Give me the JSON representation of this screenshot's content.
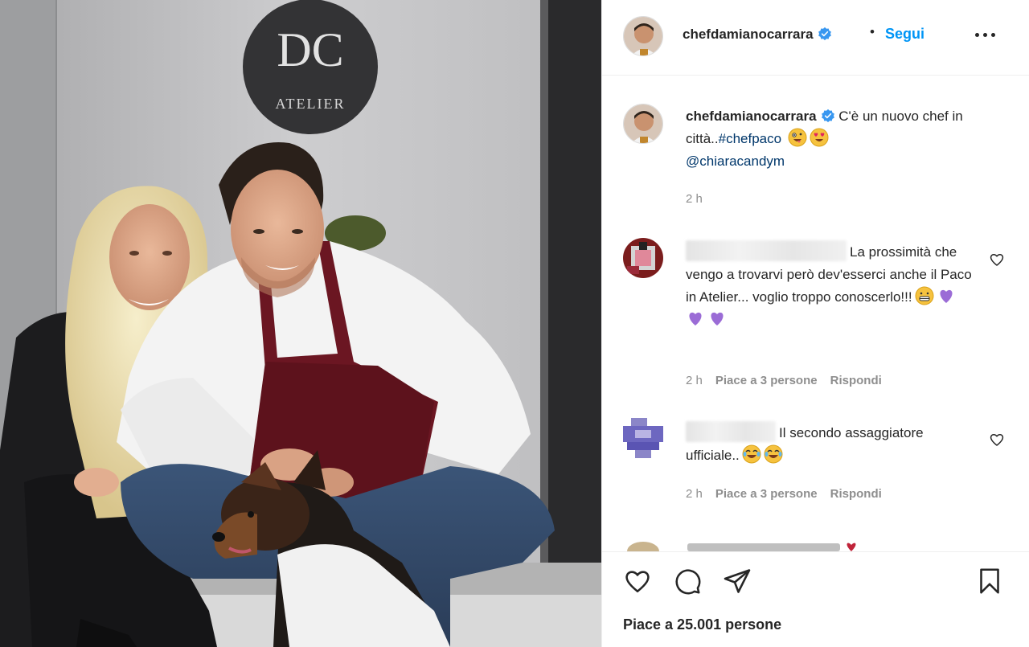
{
  "post": {
    "sign": {
      "monogram": "DC",
      "label": "ATELIER"
    }
  },
  "header": {
    "username": "chefdamianocarrara",
    "separator": "•",
    "follow_label": "Segui"
  },
  "caption": {
    "username": "chefdamianocarrara",
    "text": "C'è un nuovo chef in città..",
    "hashtag": "#chefpaco",
    "mention": "@chiaracandym",
    "time": "2 h"
  },
  "comments": [
    {
      "text": "La prossimità che vengo a trovarvi però dev'esserci anche il Paco in Atelier... voglio troppo conoscerlo!!!",
      "time": "2 h",
      "likes_label": "Piace a 3 persone",
      "reply_label": "Rispondi"
    },
    {
      "text": "Il secondo assaggiatore ufficiale..",
      "time": "2 h",
      "likes_label": "Piace a 3 persone",
      "reply_label": "Rispondi"
    }
  ],
  "footer": {
    "likes_text": "Piace a 25.001 persone"
  },
  "icons": {
    "verified": "verified-badge-icon",
    "more": "more-options-icon",
    "like": "heart-icon",
    "comment": "comment-bubble-icon",
    "share": "paper-plane-icon",
    "save": "bookmark-icon"
  },
  "colors": {
    "accent": "#0095f6",
    "verified": "#3897f0",
    "text": "#262626",
    "muted": "#8e8e8e",
    "apron": "#6b1622"
  }
}
